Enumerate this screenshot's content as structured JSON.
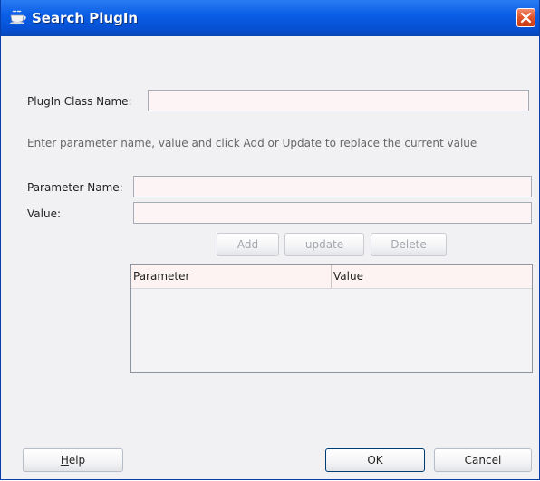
{
  "window": {
    "title": "Search PlugIn"
  },
  "form": {
    "class_name_label": "PlugIn Class Name:",
    "class_name_value": "",
    "instruction": "Enter parameter name, value and click Add or Update to replace the current value",
    "param_name_label": "Parameter Name:",
    "param_name_value": "",
    "value_label": "Value:",
    "value_value": ""
  },
  "actions": {
    "add": "Add",
    "update": "update",
    "delete": "Delete"
  },
  "table": {
    "columns": [
      "Parameter",
      "Value"
    ],
    "rows": []
  },
  "footer": {
    "help_prefix": "",
    "help_mnemonic": "H",
    "help_rest": "elp",
    "ok": "OK",
    "cancel": "Cancel"
  },
  "icons": {
    "title_icon": "coffee-cup-icon",
    "close_icon": "close-x-icon"
  },
  "colors": {
    "titlebar": "#0a5fe6",
    "close_button": "#e0532a",
    "field_background": "#fdf5f5",
    "dialog_background": "#f1f1f3"
  }
}
